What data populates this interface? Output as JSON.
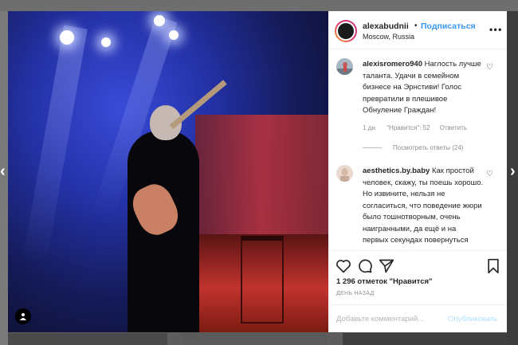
{
  "post": {
    "username": "alexabudnii",
    "separator": "•",
    "follow_label": "Подписаться",
    "location": "Moscow, Russia",
    "more_icon": "more-options-icon"
  },
  "comments": [
    {
      "username": "alexisromero940",
      "text": "Наглость лучше таланта. Удачи в семейном бизнесе на Эрнстиви! Голос превратили в плешивое Обнуление Граждан!",
      "age": "1 дн.",
      "likes": "\"Нравится\": 52",
      "reply_label": "Ответить",
      "view_replies": "Посмотреть ответы (24)"
    },
    {
      "username": "aesthetics.by.baby",
      "text": "Как простой человек, скажу, ты поешь хорошо. Но извините, нельзя не согласиться, что поведение жюри было тошнотворным, очень наигранными, да ещё и на первых секундах повернуться когда человек ничего исполнить не успел, хахпх, отвратительно )"
    }
  ],
  "stats": {
    "likes_text": "1 296 отметок \"Нравится\"",
    "time_text": "ДЕНЬ НАЗАД"
  },
  "add_comment": {
    "placeholder": "Добавьте комментарий...",
    "publish_label": "Опубликовать"
  },
  "colors": {
    "accent": "#3897f0",
    "publish_disabled": "#b2dffc",
    "muted": "#8e8e8e"
  }
}
